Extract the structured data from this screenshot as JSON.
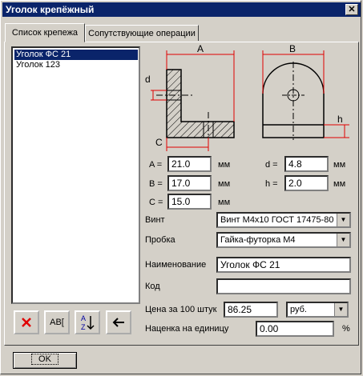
{
  "window": {
    "title": "Уголок крепёжный",
    "close_glyph": "✕"
  },
  "tabs": [
    {
      "label": "Список крепежа",
      "active": true
    },
    {
      "label": "Сопутствующие операции",
      "active": false
    }
  ],
  "list": {
    "items": [
      {
        "label": "Уголок ФС 21",
        "selected": true
      },
      {
        "label": "Уголок 123",
        "selected": false
      }
    ]
  },
  "list_buttons": [
    {
      "name": "delete",
      "icon": "red-x-icon",
      "glyph": "✕"
    },
    {
      "name": "rename",
      "icon": "rename-icon",
      "glyph": "AB["
    },
    {
      "name": "sort",
      "icon": "sort-az-icon",
      "glyph": "A↓Z"
    },
    {
      "name": "back",
      "icon": "arrow-left-icon",
      "glyph": "←"
    }
  ],
  "drawing": {
    "label_a": "A",
    "label_b": "B",
    "label_c": "C",
    "label_d": "d",
    "label_h": "h"
  },
  "dims": {
    "a_label": "A =",
    "a_value": "21.0",
    "b_label": "B =",
    "b_value": "17.0",
    "c_label": "C =",
    "c_value": "15.0",
    "d_label": "d =",
    "d_value": "4.8",
    "h_label": "h =",
    "h_value": "2.0",
    "unit": "мм"
  },
  "form": {
    "vint_label": "Винт",
    "vint_value": "Винт М4х10 ГОСТ 17475-80",
    "probka_label": "Пробка",
    "probka_value": "Гайка-футорка М4",
    "name_label": "Наименование",
    "name_value": "Уголок ФС 21",
    "code_label": "Код",
    "code_value": "",
    "price_label": "Цена за 100 штук",
    "price_value": "86.25",
    "currency_value": "руб.",
    "markup_label": "Наценка на единицу",
    "markup_value": "0.00",
    "markup_unit": "%"
  },
  "footer": {
    "ok_label": "OK"
  },
  "colors": {
    "titlebar": "#0a246a",
    "dimension": "#e00000",
    "selection": "#0a246a"
  }
}
